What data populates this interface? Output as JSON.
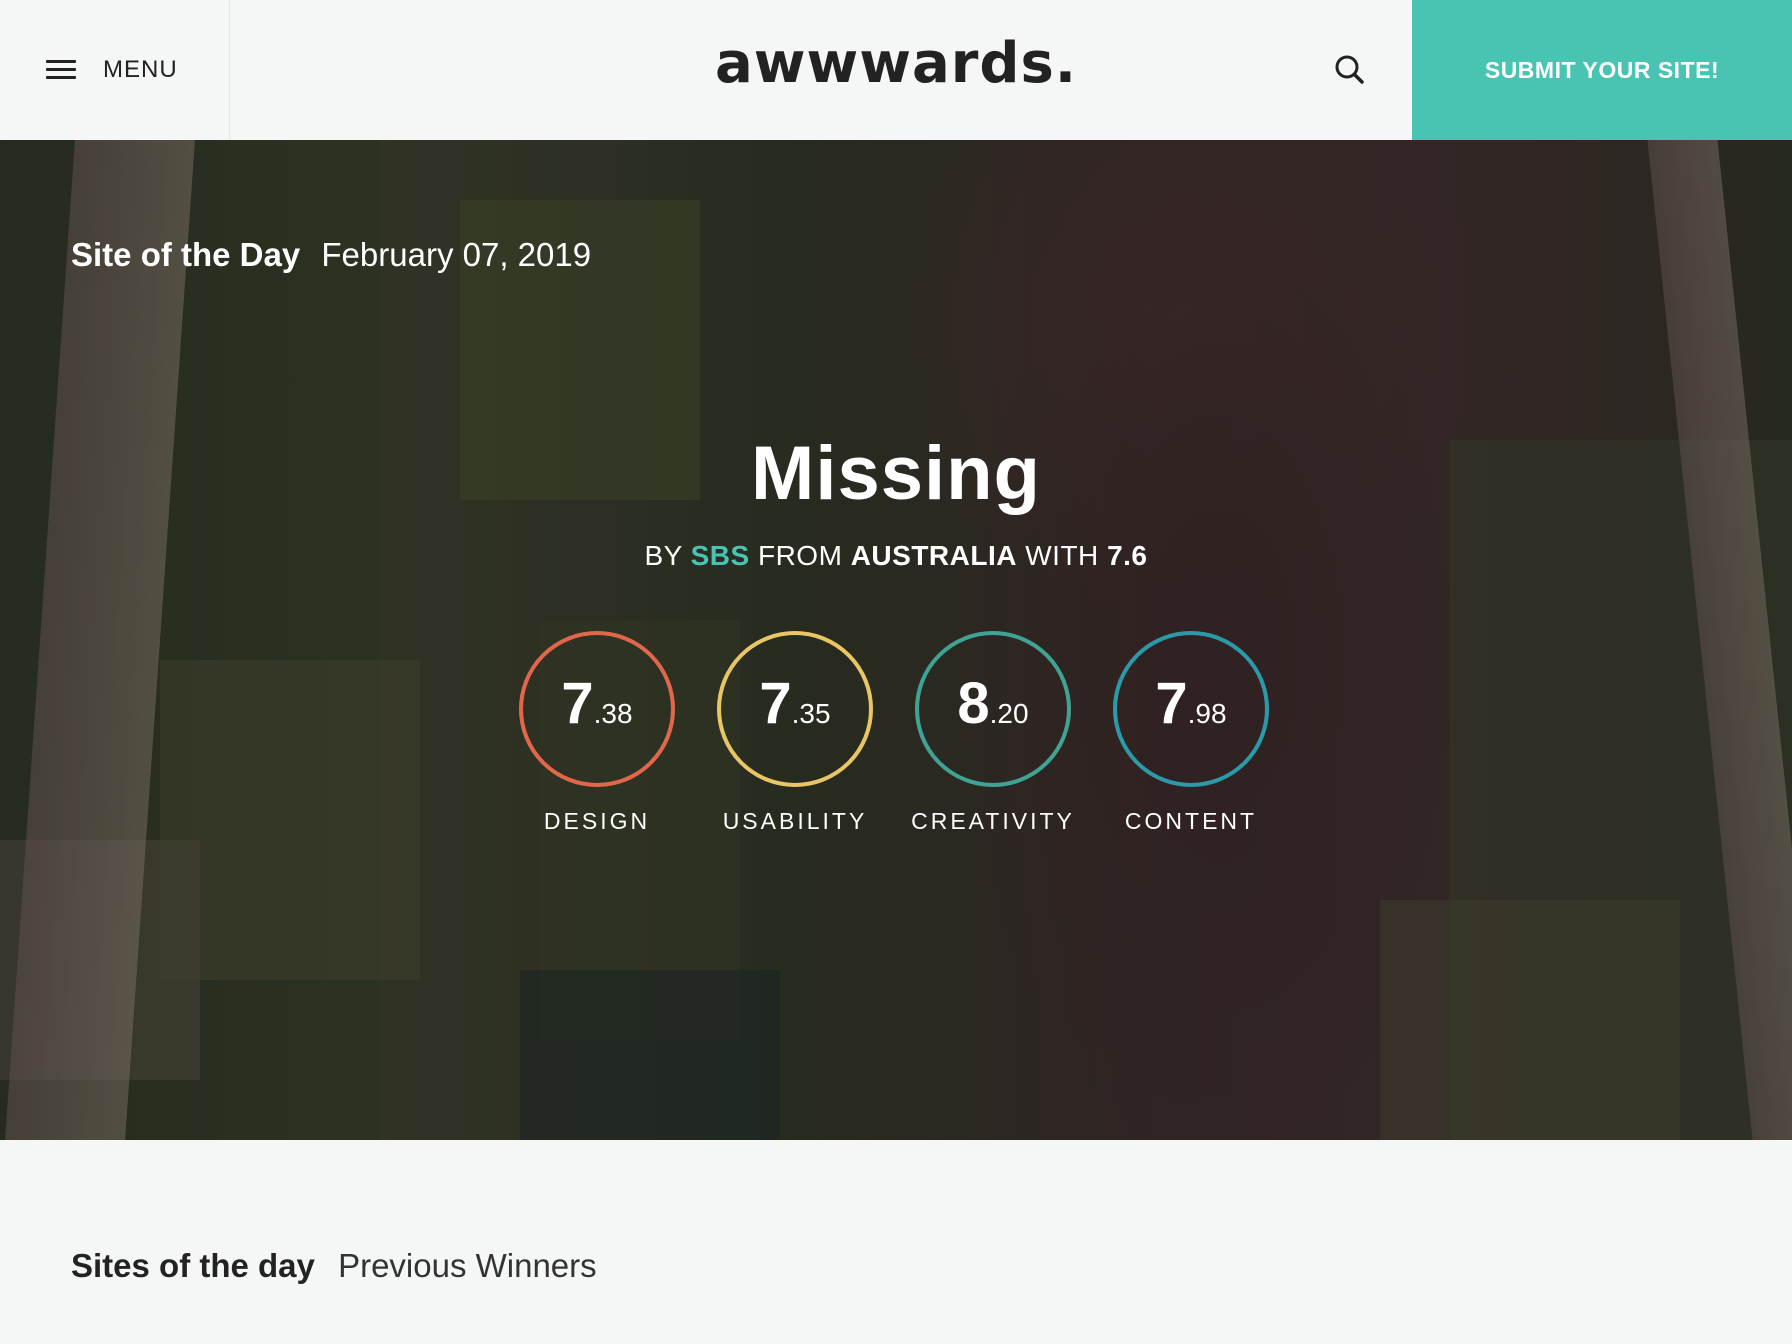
{
  "header": {
    "menu_label": "MENU",
    "logo": "awwwards.",
    "submit_label": "SUBMIT YOUR SITE!",
    "accent_color": "#4ac4b2"
  },
  "hero": {
    "badge_label": "Site of the Day",
    "date": "February 07, 2019",
    "title": "Missing",
    "by_prefix": "BY",
    "author": "SBS",
    "from_prefix": "FROM",
    "country": "AUSTRALIA",
    "with_prefix": "WITH",
    "overall_score": "7.6",
    "scores": [
      {
        "label": "DESIGN",
        "whole": "7",
        "decimal": ".38",
        "value": 7.38,
        "color": "#e2674a"
      },
      {
        "label": "USABILITY",
        "whole": "7",
        "decimal": ".35",
        "value": 7.35,
        "color": "#e9c663"
      },
      {
        "label": "CREATIVITY",
        "whole": "8",
        "decimal": ".20",
        "value": 8.2,
        "color": "#3fa393"
      },
      {
        "label": "CONTENT",
        "whole": "7",
        "decimal": ".98",
        "value": 7.98,
        "color": "#2a9aa9"
      }
    ]
  },
  "section": {
    "title": "Sites of the day",
    "subtitle": "Previous Winners"
  }
}
